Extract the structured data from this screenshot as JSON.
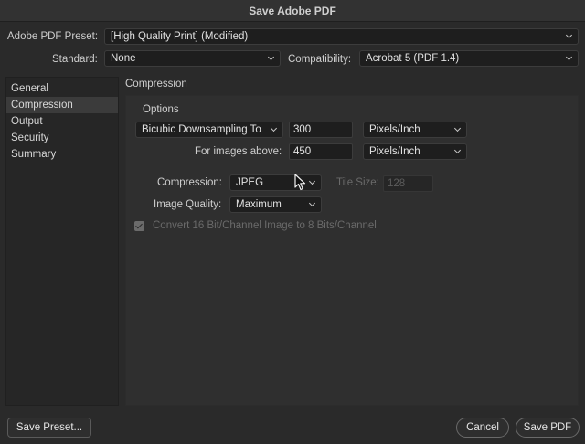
{
  "window": {
    "title": "Save Adobe PDF"
  },
  "top": {
    "preset_label": "Adobe PDF Preset:",
    "preset_value": "[High Quality Print] (Modified)",
    "standard_label": "Standard:",
    "standard_value": "None",
    "compat_label": "Compatibility:",
    "compat_value": "Acrobat 5 (PDF 1.4)"
  },
  "sidebar": {
    "items": [
      {
        "label": "General"
      },
      {
        "label": "Compression",
        "active": true
      },
      {
        "label": "Output"
      },
      {
        "label": "Security"
      },
      {
        "label": "Summary"
      }
    ]
  },
  "section": {
    "title": "Compression"
  },
  "options": {
    "title": "Options",
    "downsampling_value": "Bicubic Downsampling To",
    "resolution_value": "300",
    "resolution_unit": "Pixels/Inch",
    "above_label": "For images above:",
    "above_value": "450",
    "above_unit": "Pixels/Inch",
    "compression_label": "Compression:",
    "compression_value": "JPEG",
    "tile_label": "Tile Size:",
    "tile_value": "128",
    "quality_label": "Image Quality:",
    "quality_value": "Maximum",
    "convert_label": "Convert 16 Bit/Channel Image to 8 Bits/Channel"
  },
  "buttons": {
    "save_preset": "Save Preset...",
    "cancel": "Cancel",
    "save_pdf": "Save PDF"
  }
}
